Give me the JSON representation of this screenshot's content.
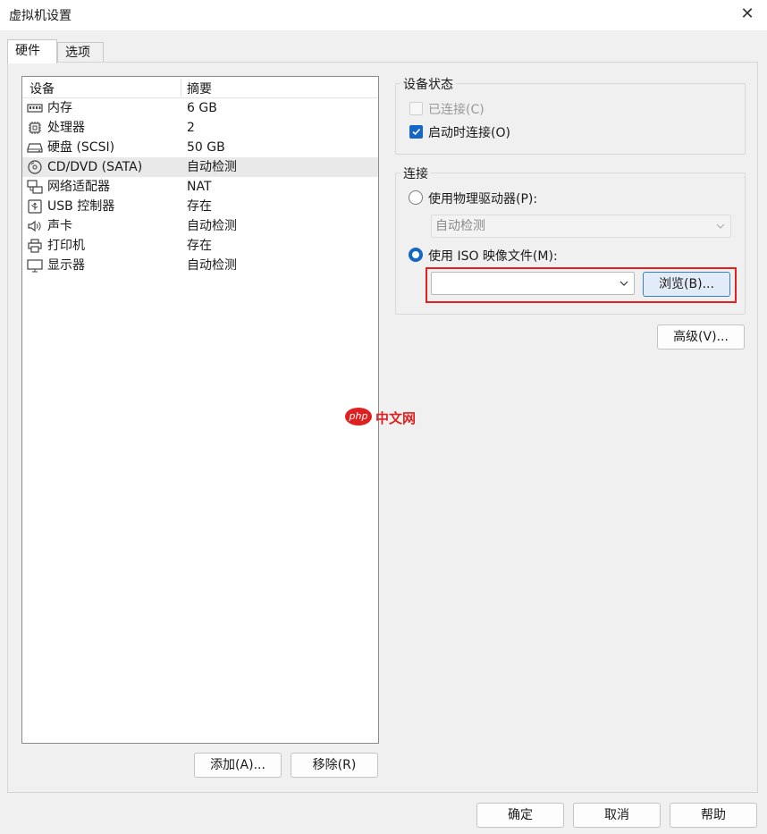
{
  "window": {
    "title": "虚拟机设置",
    "close_glyph": "✕"
  },
  "tabs": [
    {
      "label": "硬件"
    },
    {
      "label": "选项"
    }
  ],
  "device_list": {
    "col_device": "设备",
    "col_summary": "摘要",
    "rows": [
      {
        "name": "内存",
        "summary": "6 GB",
        "icon": "memory-icon"
      },
      {
        "name": "处理器",
        "summary": "2",
        "icon": "processor-icon"
      },
      {
        "name": "硬盘 (SCSI)",
        "summary": "50 GB",
        "icon": "hard-disk-icon"
      },
      {
        "name": "CD/DVD (SATA)",
        "summary": "自动检测",
        "icon": "cd-dvd-icon",
        "selected": true
      },
      {
        "name": "网络适配器",
        "summary": "NAT",
        "icon": "network-adapter-icon"
      },
      {
        "name": "USB 控制器",
        "summary": "存在",
        "icon": "usb-icon"
      },
      {
        "name": "声卡",
        "summary": "自动检测",
        "icon": "speaker-icon"
      },
      {
        "name": "打印机",
        "summary": "存在",
        "icon": "printer-icon"
      },
      {
        "name": "显示器",
        "summary": "自动检测",
        "icon": "monitor-icon"
      }
    ]
  },
  "list_buttons": {
    "add": "添加(A)...",
    "remove": "移除(R)"
  },
  "device_status": {
    "label": "设备状态",
    "connected": {
      "label": "已连接(C)",
      "checked": false,
      "enabled": false
    },
    "connect_at_power_on": {
      "label": "启动时连接(O)",
      "checked": true,
      "enabled": true
    }
  },
  "connection": {
    "label": "连接",
    "physical_drive": {
      "label": "使用物理驱动器(P):",
      "selected": false,
      "value": "自动检测"
    },
    "iso_image": {
      "label": "使用 ISO 映像文件(M):",
      "selected": true,
      "value": ""
    },
    "browse_label": "浏览(B)..."
  },
  "advanced_label": "高级(V)...",
  "footer": {
    "ok": "确定",
    "cancel": "取消",
    "help": "帮助"
  },
  "watermark": {
    "logo": "php",
    "text": "中文网"
  },
  "colors": {
    "accent": "#1467c7",
    "highlight": "#e12020"
  }
}
